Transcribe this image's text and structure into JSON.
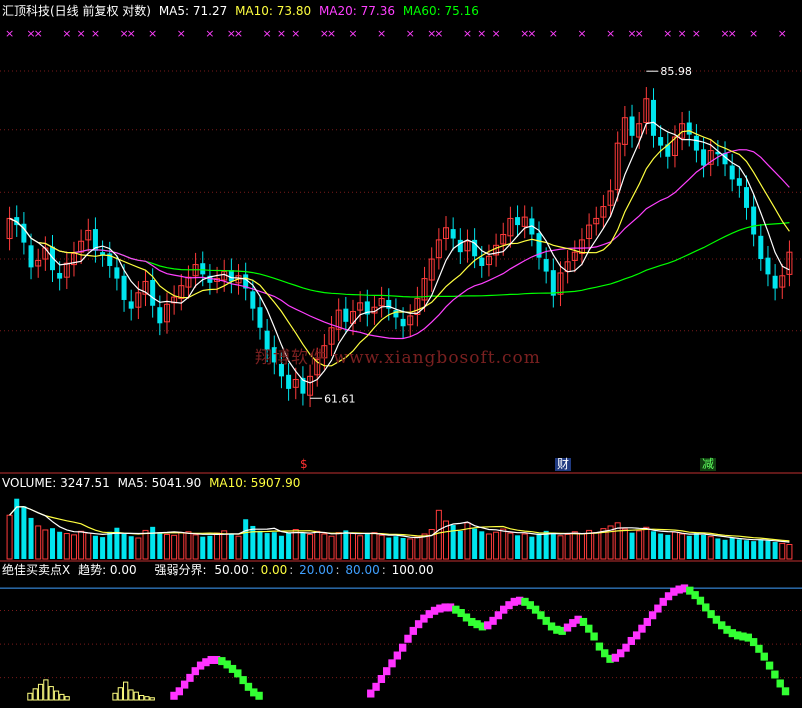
{
  "main_header": {
    "title": "汇顶科技(日线 前复权 对数)",
    "ma5": "MA5: 71.27",
    "ma10": "MA10: 73.80",
    "ma20": "MA20: 77.36",
    "ma60": "MA60: 75.16"
  },
  "volume_header": {
    "title": "VOLUME: 3247.51",
    "ma5": "MA5: 5041.90",
    "ma10": "MA10: 5907.90"
  },
  "indicator_header": {
    "title": "绝佳买卖点X",
    "trend": "趋势: 0.00",
    "levels_label": "强弱分界:",
    "levels": [
      "50.00",
      "0.00",
      "20.00",
      "80.00",
      "100.00"
    ]
  },
  "watermark": "翔博软件 www.xiangbosoft.com",
  "annotations": {
    "high": "85.98",
    "low": "61.61"
  },
  "events": [
    {
      "label": "$",
      "color": "#ff3030",
      "bg": "#000000"
    },
    {
      "label": "财",
      "color": "#ffffff",
      "bg": "#203a80"
    },
    {
      "label": "减",
      "color": "#60ff60",
      "bg": "#104010"
    }
  ],
  "colors": {
    "up": "#ff3b3b",
    "down": "#00e5ee",
    "ma5": "#ffffff",
    "ma10": "#ffff40",
    "ma20": "#ff40ff",
    "ma60": "#00ff00",
    "buy_phase": "#ff33ff",
    "sell_phase": "#33ff33"
  },
  "chart_data": [
    {
      "type": "candlestick",
      "title": "汇顶科技(日线 前复权 对数)",
      "y_scale": "log",
      "series_ma": [
        "MA5",
        "MA10",
        "MA20",
        "MA60"
      ],
      "last_ma": {
        "MA5": 71.27,
        "MA10": 73.8,
        "MA20": 77.36,
        "MA60": 75.16
      },
      "visible_high": 85.98,
      "visible_low": 61.61,
      "y_range": [
        57.5,
        90.4
      ],
      "closes": [
        74,
        73.5,
        72.2,
        70.4,
        70.9,
        71.8,
        70.2,
        69.6,
        70.7,
        71.4,
        72.3,
        73.1,
        71.6,
        71.3,
        70.5,
        69.6,
        68.1,
        67.5,
        68.6,
        69.4,
        67.7,
        66.5,
        67.8,
        68.3,
        69.1,
        69.7,
        70.6,
        69.9,
        69.3,
        69.6,
        70.1,
        69.4,
        69.8,
        68.9,
        67.5,
        66.2,
        64.7,
        63.9,
        63.0,
        62.2,
        62.8,
        61.9,
        63.0,
        64.1,
        65.0,
        66.2,
        67.4,
        66.6,
        67.3,
        67.9,
        67.1,
        67.6,
        68.2,
        67.5,
        66.9,
        66.3,
        67.0,
        68.2,
        69.6,
        71.0,
        72.4,
        73.3,
        72.5,
        71.5,
        72.3,
        71.2,
        70.5,
        71.2,
        72.0,
        72.8,
        74.0,
        73.5,
        74.1,
        72.8,
        71.1,
        70.1,
        68.4,
        70.0,
        70.8,
        71.5,
        72.4,
        73.5,
        74.0,
        74.9,
        76.1,
        79.9,
        82.0,
        80.5,
        81.5,
        83.6,
        80.5,
        79.7,
        78.8,
        80.4,
        81.5,
        80.6,
        79.3,
        78.1,
        79.3,
        79.0,
        78.2,
        77.0,
        76.5,
        74.8,
        72.8,
        71.0,
        69.9,
        68.9,
        69.8,
        71.5
      ],
      "opens": [
        72.5,
        74.1,
        73.6,
        72.0,
        70.5,
        71.0,
        71.9,
        70.0,
        69.7,
        70.6,
        71.5,
        72.4,
        73.2,
        71.5,
        71.4,
        70.4,
        69.8,
        68.0,
        67.6,
        68.5,
        69.5,
        67.6,
        66.6,
        67.9,
        68.2,
        69.0,
        69.8,
        70.7,
        69.8,
        69.4,
        69.5,
        70.2,
        69.3,
        69.9,
        68.7,
        67.6,
        66.0,
        64.9,
        63.8,
        63.1,
        62.3,
        62.9,
        61.8,
        63.1,
        64.2,
        65.1,
        66.1,
        67.5,
        66.5,
        67.4,
        68.0,
        67.2,
        67.7,
        68.1,
        67.4,
        66.8,
        66.4,
        67.1,
        68.1,
        69.5,
        71.1,
        72.5,
        73.2,
        72.4,
        71.6,
        72.4,
        71.1,
        70.6,
        71.3,
        72.1,
        72.7,
        74.1,
        73.4,
        74.0,
        72.9,
        71.0,
        70.2,
        68.5,
        70.1,
        70.9,
        71.4,
        72.5,
        73.6,
        74.1,
        75.0,
        76.2,
        79.8,
        82.1,
        80.4,
        81.6,
        83.5,
        80.4,
        79.8,
        78.9,
        80.3,
        81.6,
        80.5,
        79.4,
        78.2,
        79.2,
        79.1,
        78.1,
        77.1,
        76.4,
        74.9,
        72.7,
        71.1,
        69.8,
        69.0,
        69.9
      ]
    },
    {
      "type": "bar",
      "title": "VOLUME: 3247.51",
      "series_ma": [
        "MA5",
        "MA10"
      ],
      "last_values": {
        "VOLUME": 3247.51,
        "MA5": 5041.9,
        "MA10": 5907.9
      },
      "values": [
        9800,
        13500,
        11800,
        9200,
        7400,
        6500,
        6900,
        6100,
        5700,
        5400,
        6200,
        5800,
        5200,
        4900,
        6100,
        7000,
        5600,
        5100,
        4700,
        6400,
        7200,
        6000,
        5500,
        5300,
        5900,
        6100,
        5400,
        5000,
        5200,
        5800,
        6300,
        5700,
        5100,
        8900,
        7400,
        6300,
        5800,
        6000,
        5200,
        5900,
        6600,
        5800,
        5500,
        6200,
        5600,
        5100,
        5900,
        6400,
        5700,
        5200,
        5600,
        5900,
        5300,
        4800,
        5100,
        4700,
        4500,
        4900,
        5600,
        6600,
        10900,
        8500,
        7600,
        6300,
        8100,
        6800,
        6200,
        5600,
        6000,
        6700,
        5800,
        5300,
        5600,
        5000,
        5700,
        6300,
        5900,
        5200,
        5500,
        6100,
        5700,
        6400,
        5900,
        6800,
        7400,
        8100,
        6700,
        5900,
        6300,
        7100,
        6200,
        5700,
        5400,
        6000,
        5600,
        5200,
        5800,
        5400,
        5000,
        4600,
        4300,
        4700,
        4400,
        4200,
        4000,
        4300,
        4100,
        3800,
        3500,
        3247.51
      ],
      "ylim": [
        0,
        15000
      ]
    },
    {
      "type": "area",
      "title": "绝佳买卖点X",
      "trend": 0.0,
      "threshold_levels": [
        50,
        0,
        20,
        80,
        100
      ],
      "ylim": [
        0,
        110
      ],
      "values": [
        0,
        0,
        0,
        0,
        0,
        0,
        0,
        0,
        0,
        0,
        0,
        0,
        0,
        0,
        0,
        0,
        0,
        0,
        0,
        0,
        0,
        0,
        0,
        0,
        0,
        0,
        0,
        0,
        0,
        0,
        0,
        2,
        6,
        12,
        18,
        24,
        29,
        32,
        34,
        34,
        33,
        30,
        26,
        22,
        16,
        10,
        5,
        2,
        0,
        0,
        0,
        0,
        0,
        0,
        0,
        0,
        0,
        0,
        0,
        0,
        0,
        0,
        0,
        0,
        0,
        0,
        0,
        0,
        4,
        10,
        17,
        24,
        31,
        38,
        45,
        53,
        60,
        66,
        71,
        75,
        78,
        80,
        81,
        81,
        79,
        76,
        72,
        68,
        66,
        64,
        65,
        69,
        74,
        79,
        83,
        86,
        87,
        86,
        83,
        79,
        74,
        69,
        64,
        61,
        60,
        63,
        67,
        70,
        68,
        62,
        55,
        46,
        40,
        35,
        36,
        40,
        45,
        51,
        56,
        62,
        68,
        74,
        80,
        86,
        91,
        95,
        97,
        98,
        96,
        92,
        87,
        81,
        75,
        70,
        65,
        61,
        58,
        56,
        55,
        54,
        50,
        44,
        37,
        29,
        21,
        13,
        6,
        0
      ],
      "phase_change": "sell when value declines, buy when value rises"
    }
  ]
}
